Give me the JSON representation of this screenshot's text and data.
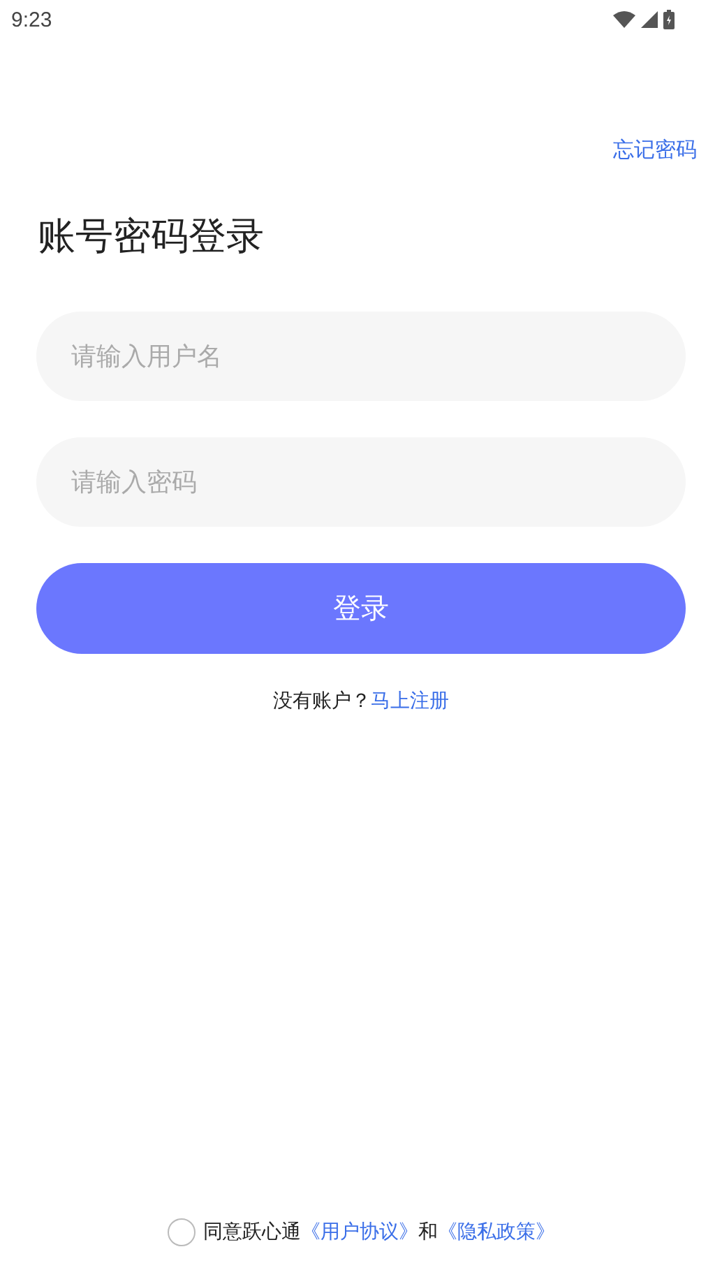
{
  "status_bar": {
    "time": "9:23"
  },
  "forgot_password": "忘记密码",
  "title": "账号密码登录",
  "fields": [
    {
      "placeholder": "请输入用户名"
    },
    {
      "placeholder": "请输入密码"
    }
  ],
  "login_button": "登录",
  "register": {
    "prompt": "没有账户？",
    "link": "马上注册"
  },
  "agreement": {
    "checked": false,
    "prefix": "同意跃心通",
    "link_1": "《用户协议》",
    "middle": "和",
    "link_2": "《隐私政策》"
  }
}
